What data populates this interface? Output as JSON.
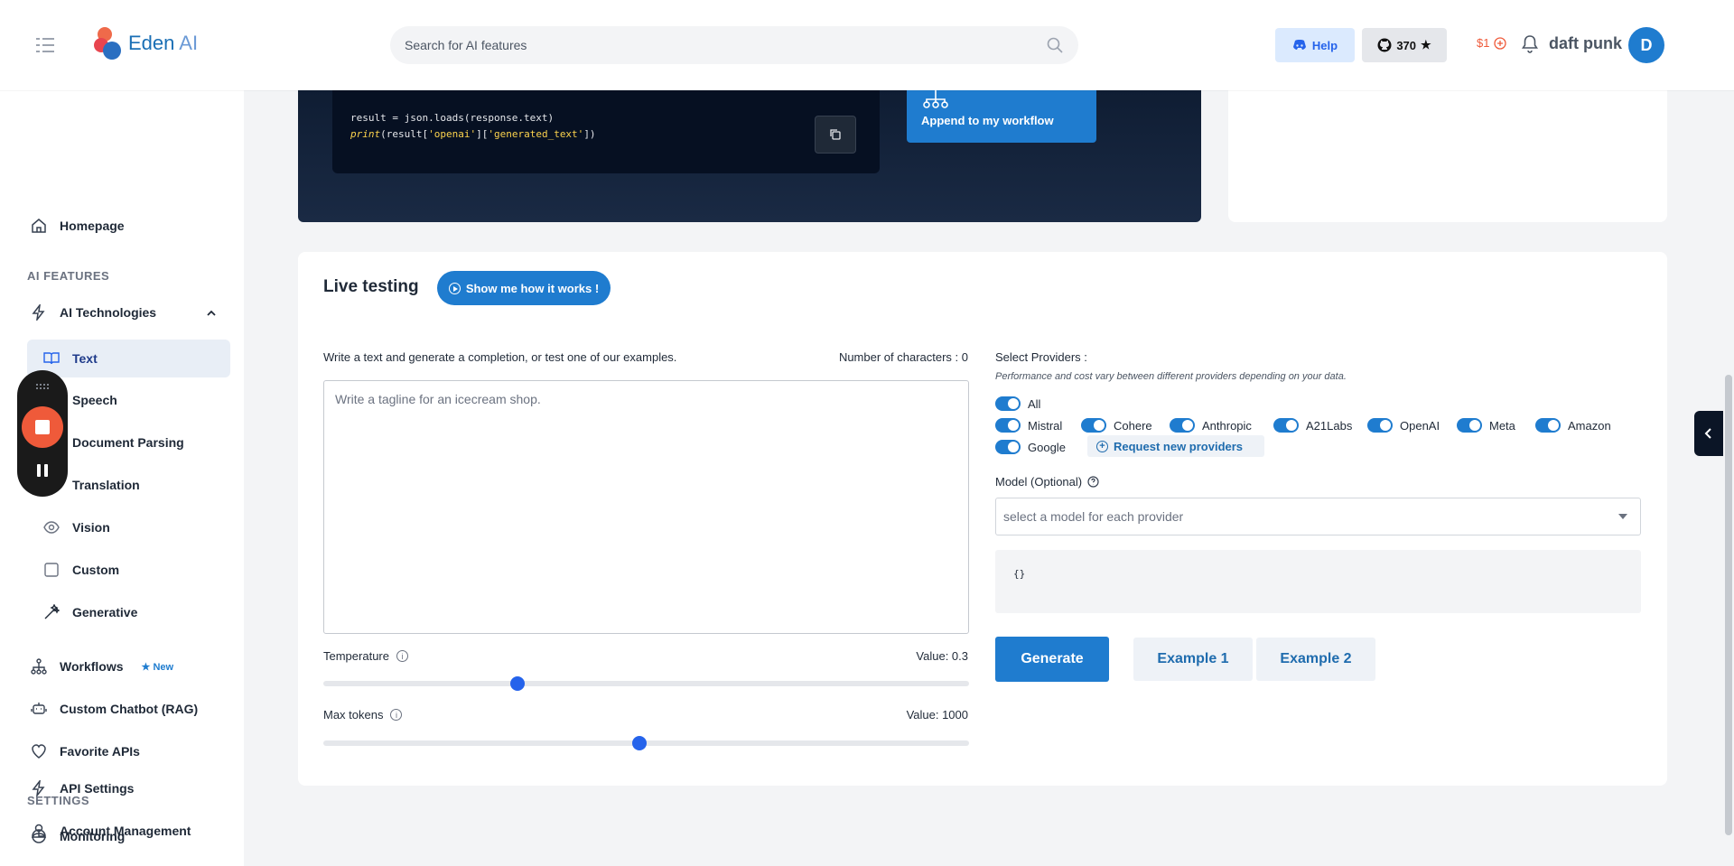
{
  "header": {
    "logo_text": "Eden",
    "logo_suffix": " AI",
    "search_placeholder": "Search for AI features",
    "help_label": "Help",
    "github_count": "370",
    "credit": "$1",
    "user_name": "daft punk",
    "avatar_initial": "D"
  },
  "sidebar": {
    "homepage": "Homepage",
    "ai_features_label": "AI FEATURES",
    "ai_technologies": "AI Technologies",
    "subitems": [
      "Text",
      "Speech",
      "Document Parsing",
      "Translation",
      "Vision",
      "Custom",
      "Generative"
    ],
    "workflows": "Workflows",
    "workflows_badge": "New",
    "chatbot": "Custom Chatbot (RAG)",
    "favorites": "Favorite APIs",
    "settings_label": "SETTINGS",
    "monitoring": "Monitoring",
    "api_settings": "API Settings",
    "account": "Account Management"
  },
  "code_card": {
    "line1": "result = json.loads(response.text)",
    "line2_fn": "print",
    "line2_open": "(result[",
    "line2_key1": "'openai'",
    "line2_mid": "][",
    "line2_key2": "'generated_text'",
    "line2_close": "])",
    "append_label": "Append to my workflow"
  },
  "live": {
    "title": "Live testing",
    "how_label": "Show me how it works !",
    "description": "Write a text and generate a completion, or test one of our examples.",
    "char_count": "Number of characters : 0",
    "prompt_placeholder": "Write a tagline for an icecream shop.",
    "temperature_label": "Temperature",
    "temperature_value": "Value: 0.3",
    "temperature": 0.3,
    "max_tokens_label": "Max tokens",
    "max_tokens_value": "Value: 1000",
    "max_tokens_fraction": 0.49,
    "providers_label": "Select Providers :",
    "providers_note": "Performance and cost vary between different providers depending on your data.",
    "all_label": "All",
    "providers": [
      "Mistral",
      "Cohere",
      "Anthropic",
      "A21Labs",
      "OpenAI",
      "Meta",
      "Amazon",
      "Google"
    ],
    "request_label": "Request new providers",
    "model_label": "Model (Optional)",
    "model_placeholder": "select a model for each provider",
    "json_text": "{}",
    "generate_label": "Generate",
    "example1_label": "Example 1",
    "example2_label": "Example 2"
  },
  "colors": {
    "accent": "#1f7ccf",
    "record": "#ef5a3a"
  }
}
